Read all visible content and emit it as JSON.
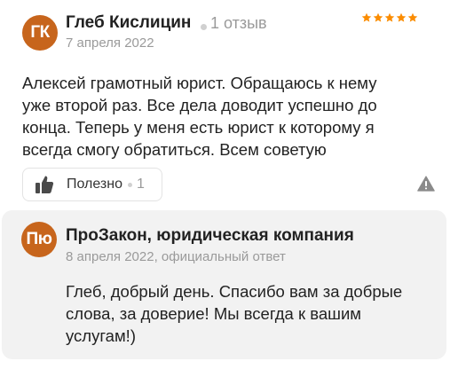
{
  "review": {
    "avatar_initials": "ГК",
    "author_name": "Глеб Кислицин",
    "reviews_count": "1 отзыв",
    "date": "7 апреля 2022",
    "rating": 5,
    "star_color": "#fb8c00",
    "text_lines": [
      "Алексей грамотный юрист. Обращаюсь к нему",
      "уже второй раз. Все дела доводит успешно до",
      "конца. Теперь у меня есть юрист к которому я",
      "всегда смогу обратиться. Всем советую"
    ],
    "helpful_label": "Полезно",
    "helpful_count": "1",
    "icons": {
      "like": "thumbs-up-icon",
      "report": "warning-triangle-icon"
    }
  },
  "reply": {
    "avatar_initials": "Пю",
    "company_name": "ПроЗакон, юридическая компания",
    "meta": "8 апреля 2022, официальный ответ",
    "text_lines": [
      "Глеб, добрый день. Спасибо вам за добрые",
      "слова, за доверие! Мы всегда к вашим",
      "услугам!)"
    ]
  },
  "colors": {
    "avatar_bg": "#c7651c",
    "reply_bg": "#f2f2f2",
    "muted_text": "#9a9a9a"
  }
}
